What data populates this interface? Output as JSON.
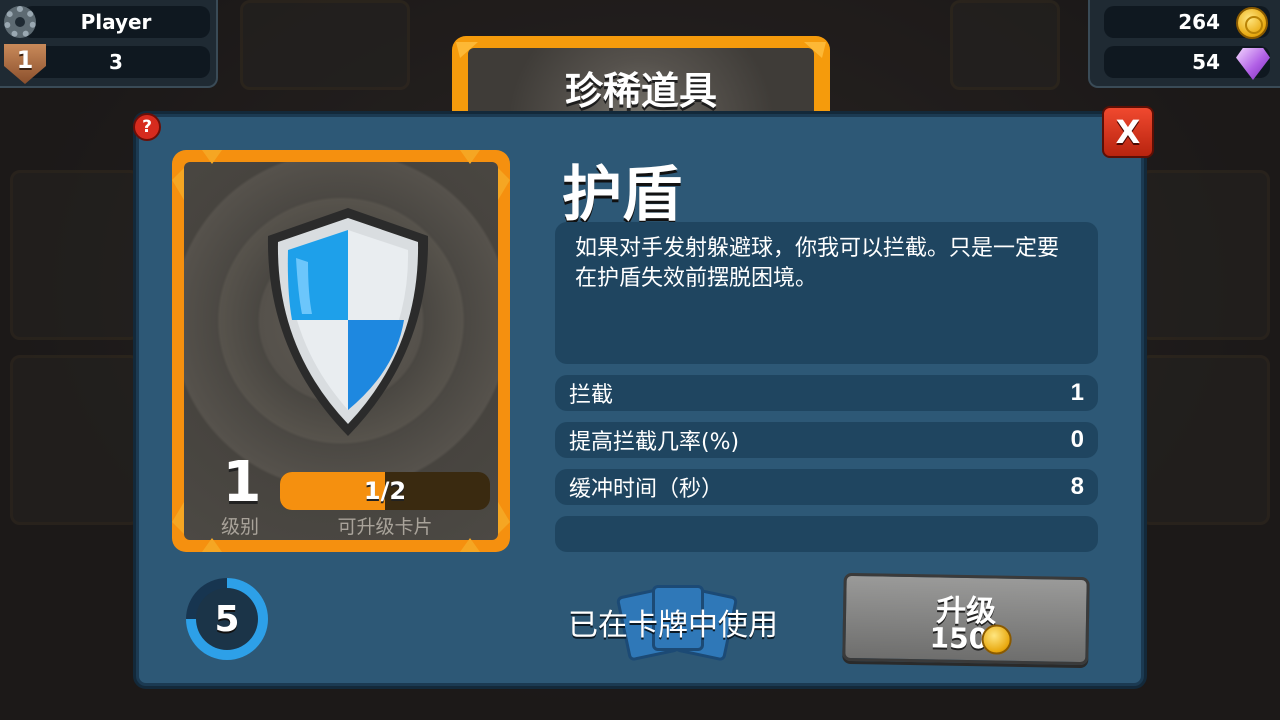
{
  "hud": {
    "player_name": "Player",
    "rank": "1",
    "trophies": "3",
    "coins": "264",
    "gems": "54"
  },
  "dialog": {
    "title": "珍稀道具",
    "help_label": "?",
    "close_label": "X"
  },
  "card": {
    "level": "1",
    "level_label": "级别",
    "progress_text": "1/2",
    "progress_fraction": 0.5,
    "progress_label": "可升级卡片",
    "energy_cost": "5",
    "energy_ring_fraction": 0.75
  },
  "item": {
    "name": "护盾",
    "description": "如果对手发射躲避球，你我可以拦截。只是一定要在护盾失效前摆脱困境。",
    "stats": [
      {
        "label": "拦截",
        "value": "1"
      },
      {
        "label": "提高拦截几率(%)",
        "value": "0"
      },
      {
        "label": "缓冲时间（秒）",
        "value": "8"
      },
      {
        "label": "",
        "value": ""
      }
    ]
  },
  "footer": {
    "in_use_text": "已在卡牌中使用",
    "upgrade_label": "升级",
    "upgrade_cost": "150"
  },
  "colors": {
    "panel": "#2d5876",
    "accent_orange": "#f5900f",
    "close_red": "#d62b1e"
  }
}
